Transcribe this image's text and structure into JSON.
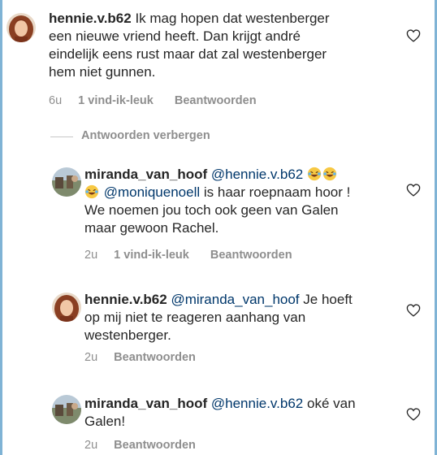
{
  "comments": [
    {
      "username": "hennie.v.b62",
      "text": "Ik mag hopen dat westenberger een nieuwe vriend heeft. Dan krijgt andré eindelijk eens rust maar dat zal westenberger hem niet gunnen.",
      "line1": "Ik mag hopen dat westenberger",
      "line2": "een nieuwe vriend heeft. Dan krijgt andré",
      "line3": "eindelijk eens rust maar dat zal westenberger",
      "line4": "hem niet gunnen.",
      "time": "6u",
      "likes": "1 vind-ik-leuk",
      "reply": "Beantwoorden",
      "avatar_icon": "profile-avatar"
    },
    {
      "username": "miranda_van_hoof",
      "mention1": "@hennie.v.b62",
      "mention2": "@moniquenoell",
      "line1_rest": "is haar roepnaam hoor !",
      "line2": "We noemen jou toch ook geen van Galen",
      "line3": "maar gewoon Rachel.",
      "time": "2u",
      "likes": "1 vind-ik-leuk",
      "reply": "Beantwoorden",
      "emoji": "laughing-tears-emoji"
    },
    {
      "username": "hennie.v.b62",
      "mention": "@miranda_van_hoof",
      "line1_rest": "Je hoeft",
      "line2": "op mij niet te reageren aanhang van",
      "line3": "westenberger.",
      "time": "2u",
      "reply": "Beantwoorden"
    },
    {
      "username": "miranda_van_hoof",
      "mention": "@hennie.v.b62",
      "line1_rest": "oké van",
      "line2": "Galen!",
      "time": "2u",
      "reply": "Beantwoorden"
    }
  ],
  "hide_replies_label": "Antwoorden verbergen",
  "icons": {
    "like": "heart-icon"
  },
  "colors": {
    "mention": "#00376b",
    "meta": "#8e8e8e",
    "text": "#262626"
  }
}
